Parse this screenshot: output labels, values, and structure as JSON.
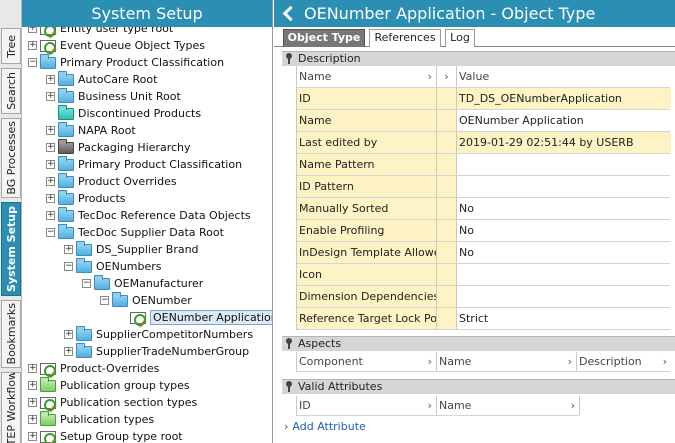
{
  "vertical_tabs": [
    {
      "label": "Tree",
      "active": false
    },
    {
      "label": "Search",
      "active": false
    },
    {
      "label": "BG Processes",
      "active": false
    },
    {
      "label": "System Setup",
      "active": true
    },
    {
      "label": "Bookmarks",
      "active": false
    },
    {
      "label": "STEP Workflow",
      "active": false
    }
  ],
  "left": {
    "title": "System Setup",
    "tree": [
      {
        "label": "Entity user type root",
        "icon": "gear",
        "exp": "+",
        "level": 0
      },
      {
        "label": "Event Queue Object Types",
        "icon": "gear",
        "exp": "+",
        "level": 0
      },
      {
        "label": "Primary Product Classification",
        "icon": "folder",
        "exp": "-",
        "level": 0
      },
      {
        "label": "AutoCare Root",
        "icon": "folder",
        "exp": "+",
        "level": 1
      },
      {
        "label": "Business Unit Root",
        "icon": "folder",
        "exp": "+",
        "level": 1
      },
      {
        "label": "Discontinued Products",
        "icon": "teal",
        "exp": "",
        "level": 1
      },
      {
        "label": "NAPA Root",
        "icon": "folder",
        "exp": "+",
        "level": 1
      },
      {
        "label": "Packaging Hierarchy",
        "icon": "gray",
        "exp": "+",
        "level": 1
      },
      {
        "label": "Primary Product Classification",
        "icon": "folder",
        "exp": "+",
        "level": 1
      },
      {
        "label": "Product Overrides",
        "icon": "folder",
        "exp": "+",
        "level": 1
      },
      {
        "label": "Products",
        "icon": "folder",
        "exp": "+",
        "level": 1
      },
      {
        "label": "TecDoc Reference Data Objects",
        "icon": "folder",
        "exp": "+",
        "level": 1
      },
      {
        "label": "TecDoc Supplier Data Root",
        "icon": "folder",
        "exp": "-",
        "level": 1
      },
      {
        "label": "DS_Supplier Brand",
        "icon": "folder",
        "exp": "+",
        "level": 2
      },
      {
        "label": "OENumbers",
        "icon": "folder",
        "exp": "-",
        "level": 2
      },
      {
        "label": "OEManufacturer",
        "icon": "folder",
        "exp": "-",
        "level": 3
      },
      {
        "label": "OENumber",
        "icon": "folder",
        "exp": "-",
        "level": 4
      },
      {
        "label": "OENumber Application",
        "icon": "gear",
        "exp": "",
        "level": 5,
        "selected": true
      },
      {
        "label": "SupplierCompetitorNumbers",
        "icon": "folder",
        "exp": "+",
        "level": 2
      },
      {
        "label": "SupplierTradeNumberGroup",
        "icon": "folder",
        "exp": "+",
        "level": 2
      },
      {
        "label": "Product-Overrides",
        "icon": "gear",
        "exp": "+",
        "level": 0
      },
      {
        "label": "Publication group types",
        "icon": "green",
        "exp": "+",
        "level": 0
      },
      {
        "label": "Publication section types",
        "icon": "gear",
        "exp": "+",
        "level": 0
      },
      {
        "label": "Publication types",
        "icon": "green",
        "exp": "+",
        "level": 0
      },
      {
        "label": "Setup Group type root",
        "icon": "gear",
        "exp": "+",
        "level": 0
      }
    ]
  },
  "right": {
    "title": "OENumber Application - Object Type",
    "tabs": [
      "Object Type",
      "References",
      "Log"
    ],
    "description": {
      "section_label": "Description",
      "col_name": "Name",
      "col_value": "Value",
      "rows": [
        {
          "name": "ID",
          "value": "TD_DS_OENumberApplication",
          "valyel": true
        },
        {
          "name": "Name",
          "value": "OENumber Application",
          "valyel": false
        },
        {
          "name": "Last edited by",
          "value": "2019-01-29 02:51:44 by USERB",
          "valyel": true
        },
        {
          "name": "Name Pattern",
          "value": "",
          "valyel": false
        },
        {
          "name": "ID Pattern",
          "value": "",
          "valyel": false
        },
        {
          "name": "Manually Sorted",
          "value": "No",
          "valyel": false
        },
        {
          "name": "Enable Profiling",
          "value": "No",
          "valyel": false
        },
        {
          "name": "InDesign Template Allowed",
          "value": "No",
          "valyel": false
        },
        {
          "name": "Icon",
          "value": "",
          "valyel": false
        },
        {
          "name": "Dimension Dependencies",
          "value": "",
          "valyel": false
        },
        {
          "name": "Reference Target Lock Policy",
          "value": "Strict",
          "valyel": false
        }
      ]
    },
    "aspects": {
      "section_label": "Aspects",
      "cols": [
        "Component",
        "Name",
        "Description"
      ]
    },
    "valid_attributes": {
      "section_label": "Valid Attributes",
      "cols": [
        "ID",
        "Name"
      ],
      "add_label": "Add Attribute"
    }
  },
  "colors": {
    "accent": "#2b8fb3",
    "highlight": "#fdf3c4"
  }
}
